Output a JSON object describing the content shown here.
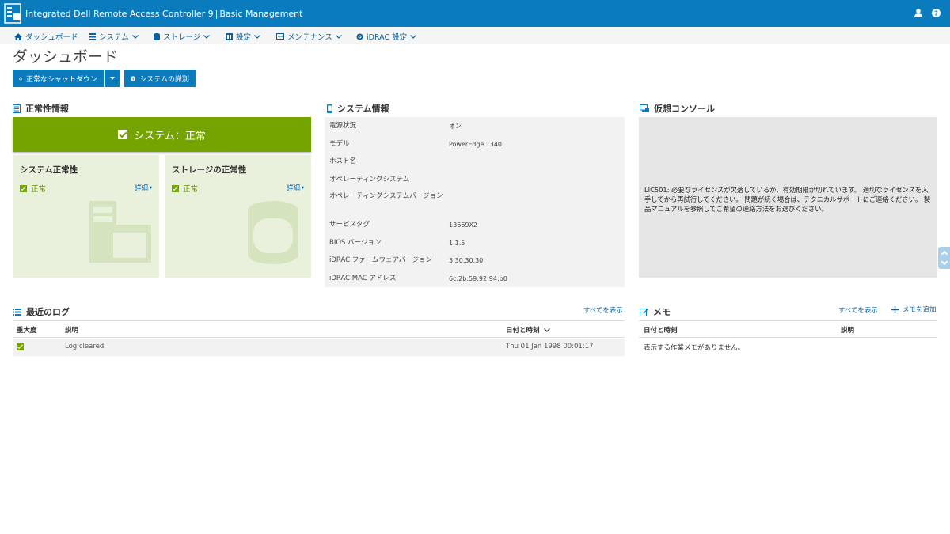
{
  "header": {
    "title_main": "Integrated Dell Remote Access Controller 9",
    "title_sub": "Basic Management",
    "colors": {
      "header_bg": "#0a7bbd",
      "health_green": "#75a300",
      "link_blue": "#0a5f9c"
    }
  },
  "nav": {
    "items": [
      {
        "label": "ダッシュボード",
        "icon": "home-icon"
      },
      {
        "label": "システム",
        "icon": "server-icon"
      },
      {
        "label": "ストレージ",
        "icon": "database-icon"
      },
      {
        "label": "設定",
        "icon": "settings-icon"
      },
      {
        "label": "メンテナンス",
        "icon": "maintenance-icon"
      },
      {
        "label": "iDRAC 設定",
        "icon": "idrac-settings-icon"
      }
    ]
  },
  "page": {
    "title": "ダッシュボード"
  },
  "actions": {
    "shutdown_label": "正常なシャットダウン",
    "identify_label": "システムの識別"
  },
  "health": {
    "section_title": "正常性情報",
    "system_status": "システム：正常",
    "system_card": {
      "title": "システム正常性",
      "status": "正常",
      "detail": "詳細"
    },
    "storage_card": {
      "title": "ストレージの正常性",
      "status": "正常",
      "detail": "詳細"
    }
  },
  "sysinfo": {
    "section_title": "システム情報",
    "rows": [
      {
        "label": "電源状況",
        "value": "オン"
      },
      {
        "label": "モデル",
        "value": "PowerEdge T340"
      },
      {
        "label": "ホスト名",
        "value": ""
      },
      {
        "label": "オペレーティングシステム",
        "value": ""
      },
      {
        "label": "オペレーティングシステムバージョン",
        "value": ""
      },
      {
        "label": "サービスタグ",
        "value": "13669X2"
      },
      {
        "label": "BIOS バージョン",
        "value": "1.1.5"
      },
      {
        "label": "iDRAC ファームウェアバージョン",
        "value": "3.30.30.30"
      },
      {
        "label": "iDRAC MAC アドレス",
        "value": "6c:2b:59:92:94:b0"
      }
    ]
  },
  "console": {
    "section_title": "仮想コンソール",
    "message": "LIC501: 必要なライセンスが欠落しているか、有効期限が切れています。 適切なライセンスを入手してから再試行してください。 問題が続く場合は、テクニカルサポートにご連絡ください。 製品マニュアルを参照してご希望の連絡方法をお選びください。"
  },
  "logs": {
    "section_title": "最近のログ",
    "view_all": "すべてを表示",
    "columns": [
      "重大度",
      "説明",
      "日付と時刻"
    ],
    "rows": [
      {
        "description": "Log cleared.",
        "datetime": "Thu 01 Jan 1998 00:01:17"
      }
    ]
  },
  "memo": {
    "section_title": "メモ",
    "view_all": "すべてを表示",
    "add": "メモを追加",
    "columns": [
      "日付と時刻",
      "説明"
    ],
    "empty": "表示する作業メモがありません。"
  }
}
